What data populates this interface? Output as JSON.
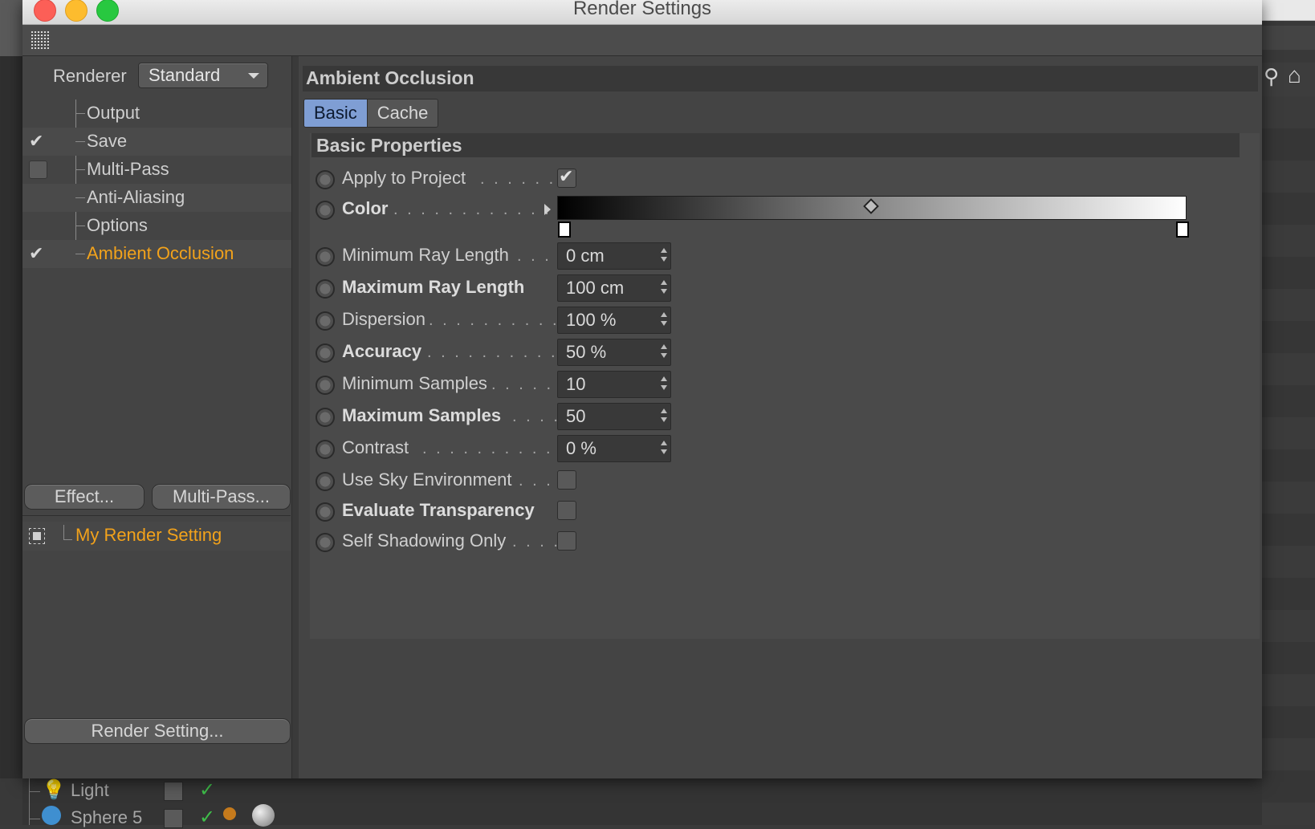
{
  "window": {
    "title": "Render Settings"
  },
  "sidebar": {
    "renderer_label": "Renderer",
    "renderer_value": "Standard",
    "items": [
      {
        "label": "Output",
        "checkbox": "none",
        "active": false
      },
      {
        "label": "Save",
        "checkbox": "checked",
        "active": false
      },
      {
        "label": "Multi-Pass",
        "checkbox": "unchecked",
        "active": false
      },
      {
        "label": "Anti-Aliasing",
        "checkbox": "none",
        "active": false
      },
      {
        "label": "Options",
        "checkbox": "none",
        "active": false
      },
      {
        "label": "Ambient Occlusion",
        "checkbox": "checked",
        "active": true
      }
    ],
    "effect_button": "Effect...",
    "multipass_button": "Multi-Pass...",
    "preset_label": "My Render Setting",
    "render_setting_button": "Render Setting..."
  },
  "panel": {
    "title": "Ambient Occlusion",
    "tabs": [
      {
        "label": "Basic",
        "active": true
      },
      {
        "label": "Cache",
        "active": false
      }
    ],
    "subsection_title": "Basic Properties",
    "properties": {
      "apply_to_project": {
        "label": "Apply to Project",
        "dots": ". . . . . . .",
        "checked": true
      },
      "color": {
        "label": "Color",
        "dots": ". . . . . . . . . . . . . . . ."
      },
      "min_ray_length": {
        "label": "Minimum Ray Length",
        "dots": ". . . .",
        "value": "0 cm"
      },
      "max_ray_length": {
        "label": "Maximum Ray Length",
        "dots": "",
        "value": "100 cm"
      },
      "dispersion": {
        "label": "Dispersion",
        "dots": ". . . . . . . . . . . . .",
        "value": "100 %"
      },
      "accuracy": {
        "label": "Accuracy",
        "dots": ". . . . . . . . . . . . . .",
        "value": "50 %"
      },
      "min_samples": {
        "label": "Minimum Samples",
        "dots": ". . . . . .",
        "value": "10"
      },
      "max_samples": {
        "label": "Maximum Samples",
        "dots": ". . . .",
        "value": "50"
      },
      "contrast": {
        "label": "Contrast",
        "dots": ". . . . . . . . . . . . . . .",
        "value": "0 %"
      },
      "use_sky_env": {
        "label": "Use Sky Environment",
        "dots": ". . . .",
        "checked": false
      },
      "eval_transparency": {
        "label": "Evaluate Transparency",
        "dots": "",
        "checked": false
      },
      "self_shadowing": {
        "label": "Self Shadowing Only",
        "dots": ". . . . .",
        "checked": false
      }
    }
  },
  "background": {
    "objects": [
      {
        "name": "Light"
      },
      {
        "name": "Sphere 5"
      }
    ]
  },
  "colors": {
    "accent_active": "#f2a21b",
    "tab_active": "#7f9ed4",
    "check_green": "#3fbf4a"
  }
}
